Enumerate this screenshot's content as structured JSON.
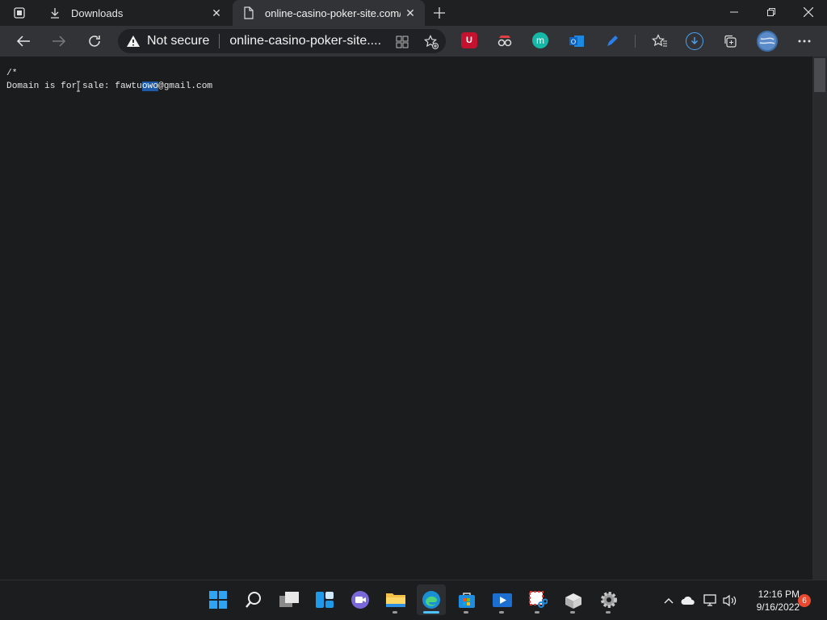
{
  "browser": {
    "tabs": [
      {
        "title": "Downloads",
        "icon": "download-icon",
        "active": false
      },
      {
        "title": "online-casino-poker-site.com/c/f",
        "icon": "page-icon",
        "active": true
      }
    ],
    "address_bar": {
      "security_label": "Not secure",
      "url": "online-casino-poker-site...."
    }
  },
  "page": {
    "lines": [
      "/*",
      "Domain is for sale: fawtu",
      "owo",
      "@gmail.com"
    ],
    "selected_text": "owo",
    "selection_color": "#1e5aa8",
    "background": "#1b1c1e"
  },
  "taskbar": {
    "apps": [
      "start-icon",
      "search-icon",
      "task-view-icon",
      "widgets-icon",
      "teams-chat-icon",
      "file-explorer-icon",
      "edge-icon",
      "store-icon",
      "media-player-icon",
      "snipping-tool-icon",
      "app-package-icon",
      "settings-icon"
    ],
    "clock_time": "12:16 PM",
    "clock_date": "9/16/2022",
    "notification_count": "6"
  }
}
